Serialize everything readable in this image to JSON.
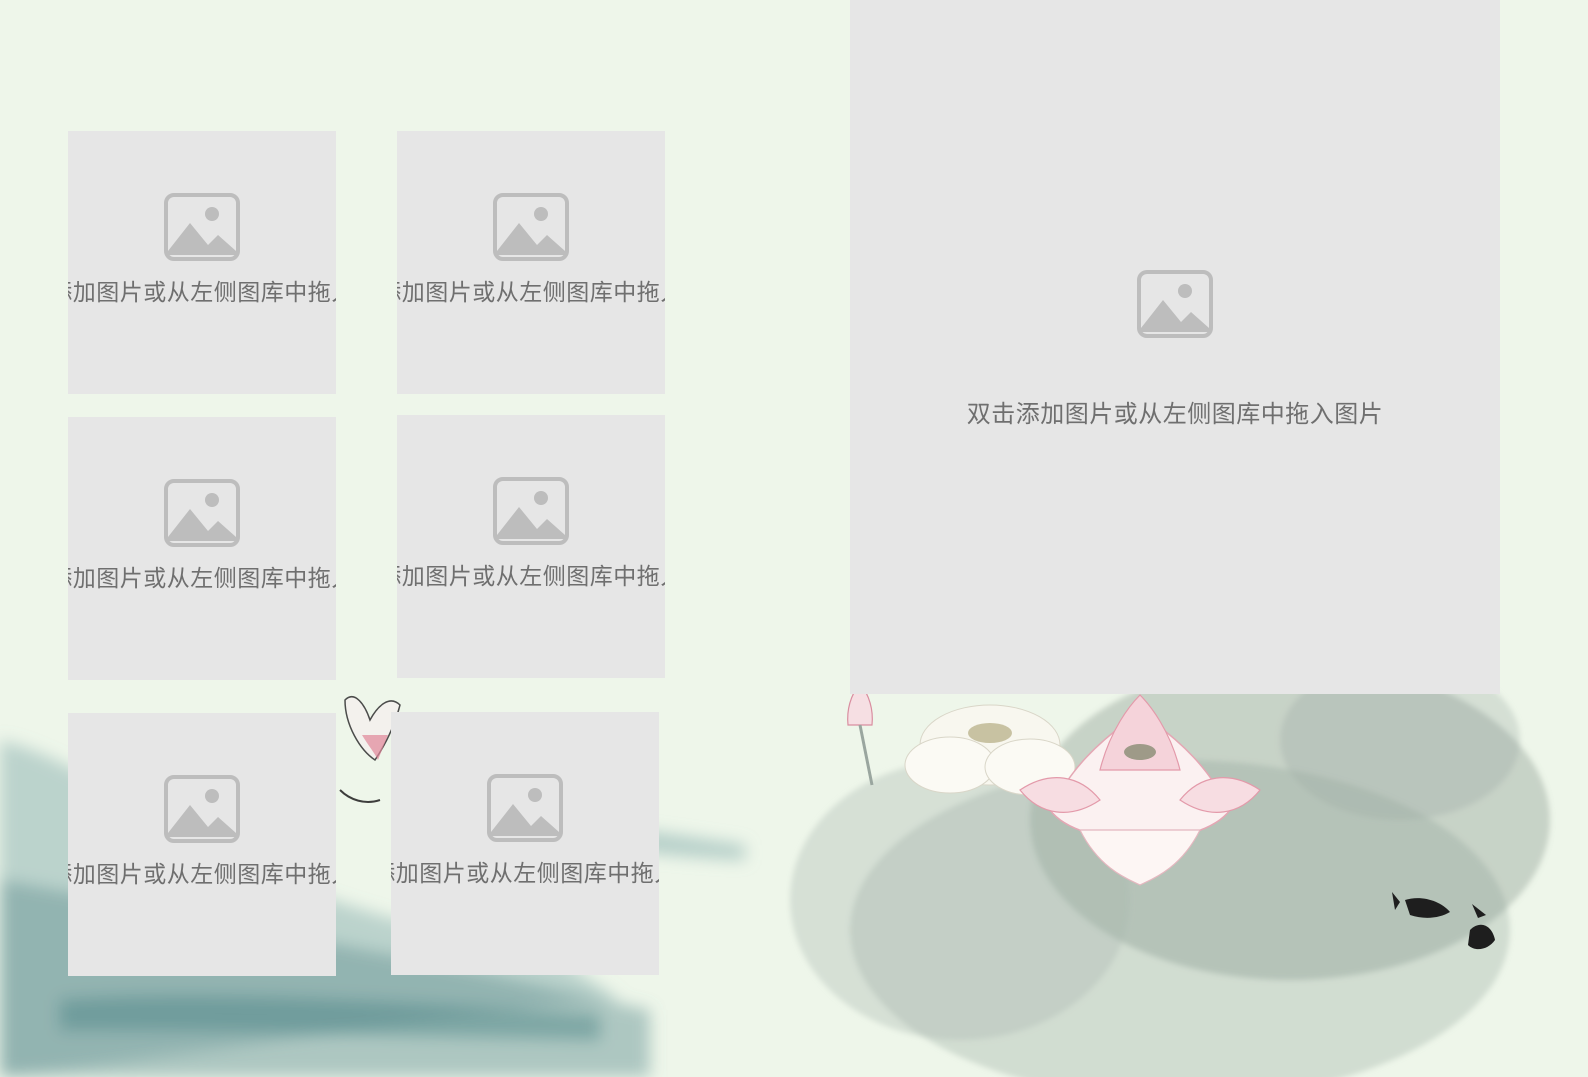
{
  "slide": {
    "background_color": "#eef6ea",
    "placeholder_color": "#e6e6e6",
    "placeholders": [
      {
        "id": "small-1",
        "icon": "image-placeholder-icon",
        "text": "双击添加图片或从左侧图库中拖入图片"
      },
      {
        "id": "small-2",
        "icon": "image-placeholder-icon",
        "text": "双击添加图片或从左侧图库中拖入图片"
      },
      {
        "id": "small-3",
        "icon": "image-placeholder-icon",
        "text": "双击添加图片或从左侧图库中拖入图片"
      },
      {
        "id": "small-4",
        "icon": "image-placeholder-icon",
        "text": "双击添加图片或从左侧图库中拖入图片"
      },
      {
        "id": "small-5",
        "icon": "image-placeholder-icon",
        "text": "双击添加图片或从左侧图库中拖入图片"
      },
      {
        "id": "small-6",
        "icon": "image-placeholder-icon",
        "text": "双击添加图片或从左侧图库中拖入图片"
      },
      {
        "id": "large-1",
        "icon": "image-placeholder-icon",
        "text": "双击添加图片或从左侧图库中拖入图片"
      }
    ]
  }
}
